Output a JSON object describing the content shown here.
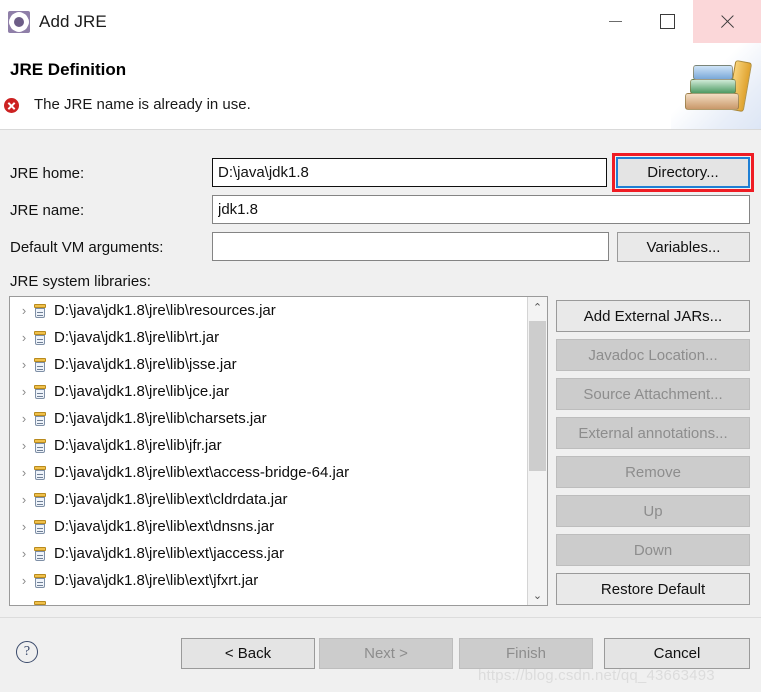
{
  "window": {
    "title": "Add JRE",
    "icon": "jre-gear-icon",
    "controls": {
      "minimize": "minimize-icon",
      "maximize": "maximize-icon",
      "close": "close-icon"
    }
  },
  "header": {
    "title": "JRE Definition",
    "message": "The JRE name is already in use.",
    "message_icon": "error-icon",
    "banner_icon": "books-stack-icon",
    "error_color": "#cc2222"
  },
  "form": {
    "jre_home": {
      "label": "JRE home:",
      "value": "D:\\java\\jdk1.8",
      "placeholder": ""
    },
    "jre_name": {
      "label": "JRE name:",
      "value": "jdk1.8",
      "placeholder": ""
    },
    "vm_args": {
      "label": "Default VM arguments:",
      "value": "",
      "placeholder": ""
    },
    "system_libraries_label": "JRE system libraries:",
    "directory_button": "Directory...",
    "variables_button": "Variables..."
  },
  "annotation": {
    "color": "#ef1c24",
    "target": "Directory..."
  },
  "libraries": [
    {
      "path": "D:\\java\\jdk1.8\\jre\\lib\\resources.jar",
      "expandable": true
    },
    {
      "path": "D:\\java\\jdk1.8\\jre\\lib\\rt.jar",
      "expandable": true
    },
    {
      "path": "D:\\java\\jdk1.8\\jre\\lib\\jsse.jar",
      "expandable": true
    },
    {
      "path": "D:\\java\\jdk1.8\\jre\\lib\\jce.jar",
      "expandable": true
    },
    {
      "path": "D:\\java\\jdk1.8\\jre\\lib\\charsets.jar",
      "expandable": true
    },
    {
      "path": "D:\\java\\jdk1.8\\jre\\lib\\jfr.jar",
      "expandable": true
    },
    {
      "path": "D:\\java\\jdk1.8\\jre\\lib\\ext\\access-bridge-64.jar",
      "expandable": true
    },
    {
      "path": "D:\\java\\jdk1.8\\jre\\lib\\ext\\cldrdata.jar",
      "expandable": true
    },
    {
      "path": "D:\\java\\jdk1.8\\jre\\lib\\ext\\dnsns.jar",
      "expandable": true
    },
    {
      "path": "D:\\java\\jdk1.8\\jre\\lib\\ext\\jaccess.jar",
      "expandable": true
    },
    {
      "path": "D:\\java\\jdk1.8\\jre\\lib\\ext\\jfxrt.jar",
      "expandable": true
    }
  ],
  "side_buttons": [
    {
      "label": "Add External JARs...",
      "enabled": true
    },
    {
      "label": "Javadoc Location...",
      "enabled": false
    },
    {
      "label": "Source Attachment...",
      "enabled": false
    },
    {
      "label": "External annotations...",
      "enabled": false
    },
    {
      "label": "Remove",
      "enabled": false
    },
    {
      "label": "Up",
      "enabled": false
    },
    {
      "label": "Down",
      "enabled": false
    },
    {
      "label": "Restore Default",
      "enabled": true
    }
  ],
  "footer": {
    "help_icon": "help-icon",
    "help_glyph": "?",
    "back_button": "< Back",
    "next_button": "Next >",
    "finish_button": "Finish",
    "cancel_button": "Cancel"
  },
  "watermark": "https://blog.csdn.net/qq_43663493",
  "icons": {
    "chevron_right": "›",
    "chevron_up": "⌃",
    "chevron_down": "⌄"
  }
}
